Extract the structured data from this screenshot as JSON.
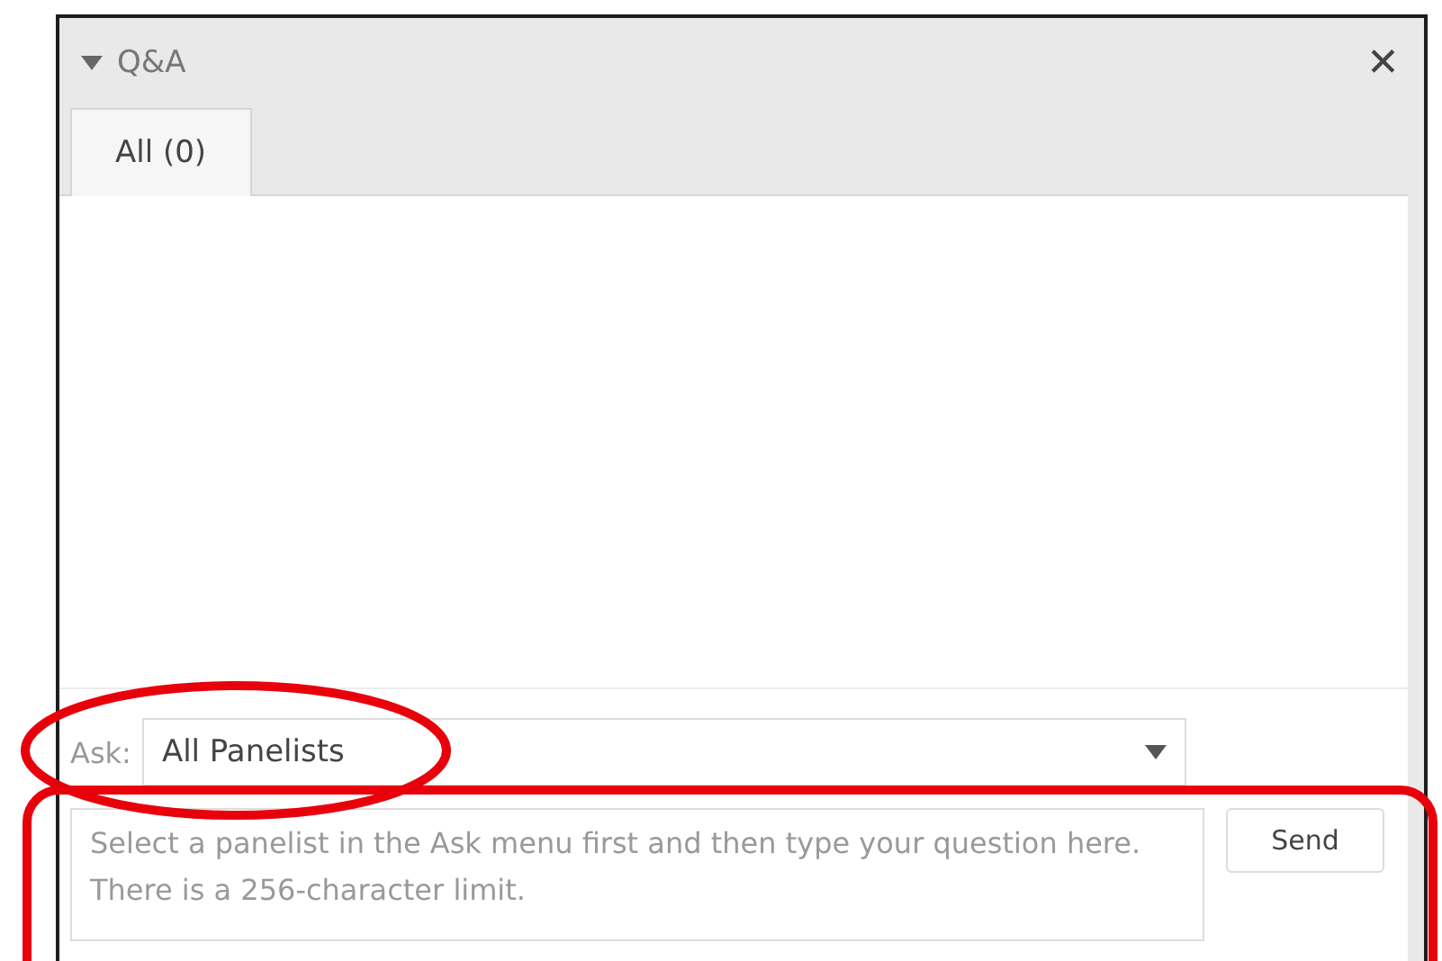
{
  "panel": {
    "title": "Q&A",
    "expanded": true
  },
  "tabs": [
    {
      "label": "All (0)",
      "selected": true
    }
  ],
  "ask": {
    "label": "Ask:",
    "value": "All Panelists",
    "highlight": {
      "kind": "ellipse"
    }
  },
  "question": {
    "placeholder": "Select a panelist in the Ask menu first and then type your question here. There is a 256-character limit.",
    "highlight": {
      "kind": "rect"
    }
  },
  "close_button": "✕",
  "buttons": [
    "Send"
  ]
}
